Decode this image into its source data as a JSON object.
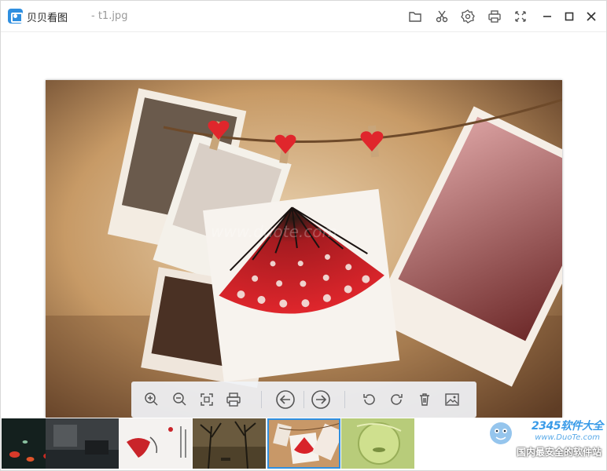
{
  "titlebar": {
    "app_name": "贝贝看图",
    "file_name": "- t1.jpg",
    "buttons": [
      {
        "name": "open-folder-button",
        "icon": "folder-icon"
      },
      {
        "name": "cut-button",
        "icon": "scissors-icon"
      },
      {
        "name": "settings-button",
        "icon": "gear-icon"
      },
      {
        "name": "print-button",
        "icon": "printer-icon"
      },
      {
        "name": "fullscreen-button",
        "icon": "expand-icon"
      },
      {
        "name": "minimize-button",
        "icon": "minimize-icon"
      },
      {
        "name": "maximize-button",
        "icon": "maximize-icon"
      },
      {
        "name": "close-button",
        "icon": "close-icon"
      }
    ]
  },
  "viewer": {
    "image_watermark": "www.duote.com"
  },
  "toolbar": {
    "tools": [
      "zoom-in-icon",
      "zoom-out-icon",
      "fit-window-icon",
      "printer-icon",
      "previous-arrow-icon",
      "next-arrow-icon",
      "rotate-left-icon",
      "rotate-right-icon",
      "trash-icon",
      "wallpaper-icon"
    ]
  },
  "filmstrip": {
    "active_index": 4,
    "count": 6
  },
  "watermark": {
    "logo": "2345软件大全",
    "url": "www.DuoTe.com",
    "tagline": "国内最安全的软件站"
  },
  "colors": {
    "accent": "#2f8fe0",
    "fan_red": "#d8232a"
  }
}
